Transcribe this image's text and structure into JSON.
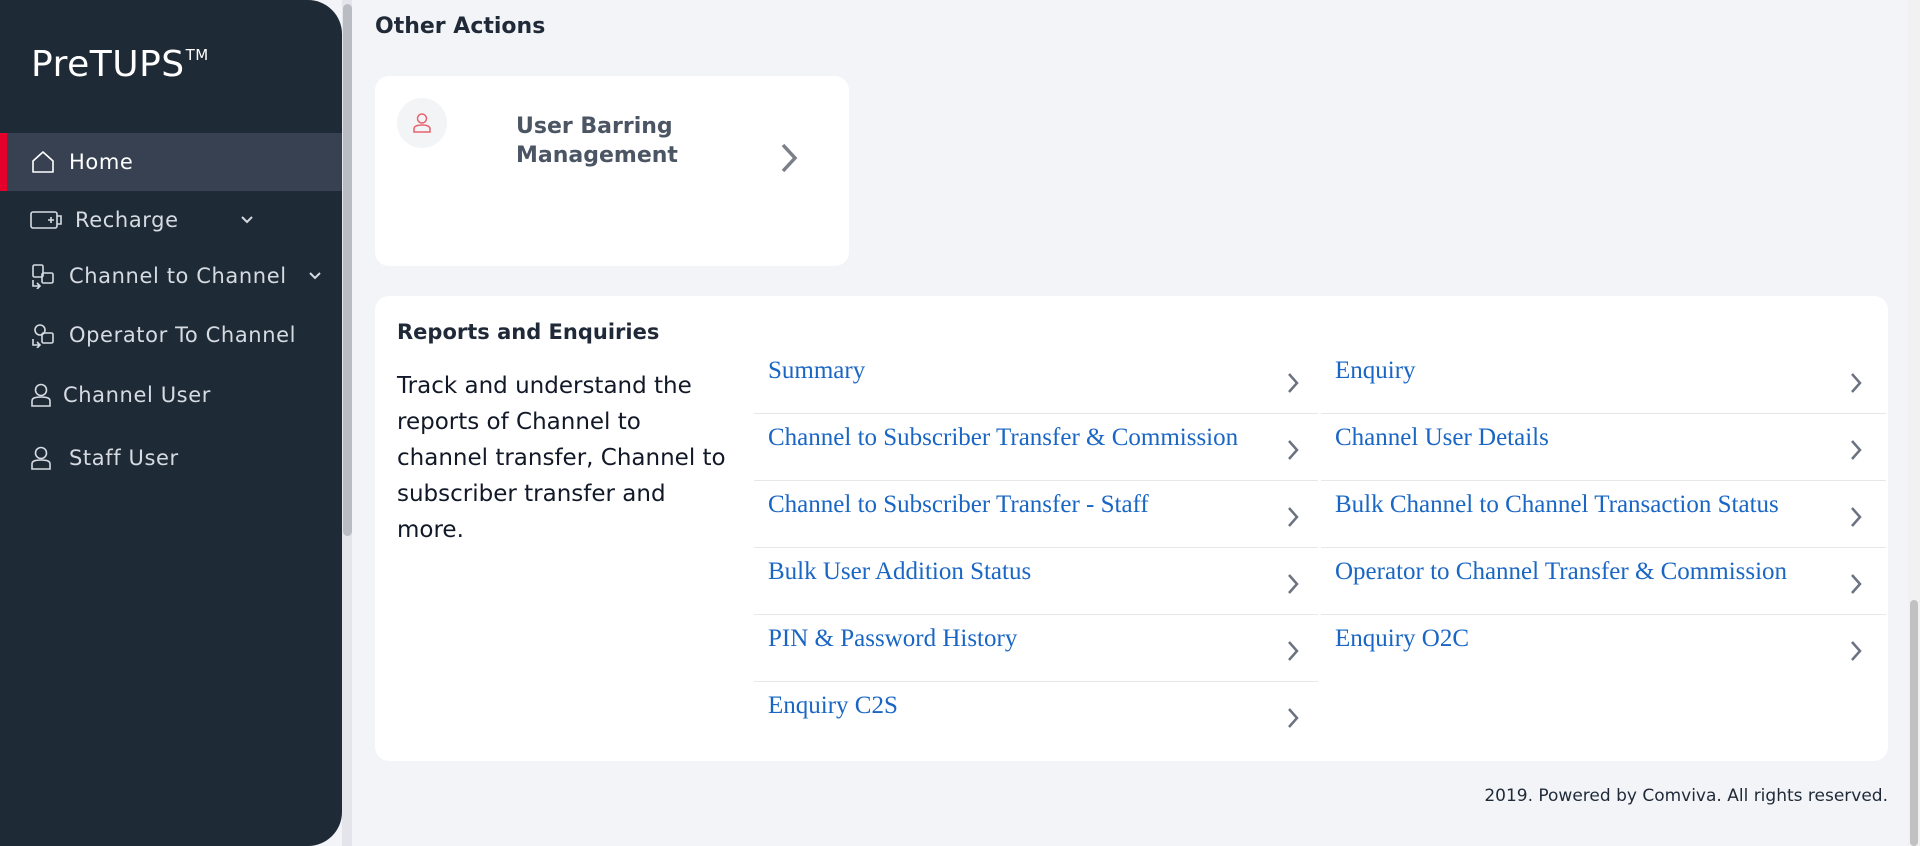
{
  "sidebar": {
    "brand": "PreTUPS",
    "brand_tm": "TM",
    "items": [
      {
        "label": "Home",
        "icon": "home-icon"
      },
      {
        "label": "Recharge",
        "icon": "recharge-icon"
      },
      {
        "label": "Channel to Channel",
        "icon": "transfer-icon"
      },
      {
        "label": "Operator To Channel",
        "icon": "operator-icon"
      },
      {
        "label": "Channel User",
        "icon": "user-icon"
      },
      {
        "label": "Staff User",
        "icon": "user-icon"
      }
    ]
  },
  "other_actions": {
    "title": "Other Actions",
    "cards": [
      {
        "label": "User Barring Management",
        "icon": "user-icon"
      }
    ]
  },
  "reports": {
    "title": "Reports and Enquiries",
    "description": "Track and understand the reports of Channel to channel transfer, Channel to subscriber transfer and more.",
    "left_links": [
      "Summary",
      "Channel to Subscriber Transfer & Commission",
      "Channel to Subscriber Transfer - Staff",
      "Bulk User Addition Status",
      "PIN & Password History",
      "Enquiry C2S"
    ],
    "right_links": [
      "Enquiry",
      "Channel User Details",
      "Bulk Channel to Channel Transaction Status",
      "Operator to Channel Transfer & Commission",
      "Enquiry O2C"
    ]
  },
  "footer": {
    "text": "2019. Powered by Comviva. All rights reserved."
  },
  "colors": {
    "sidebar_bg": "#1f2a37",
    "active_bg": "#374151",
    "accent": "#e4002b",
    "link": "#1a66c4",
    "page_bg": "#f3f4f8"
  }
}
